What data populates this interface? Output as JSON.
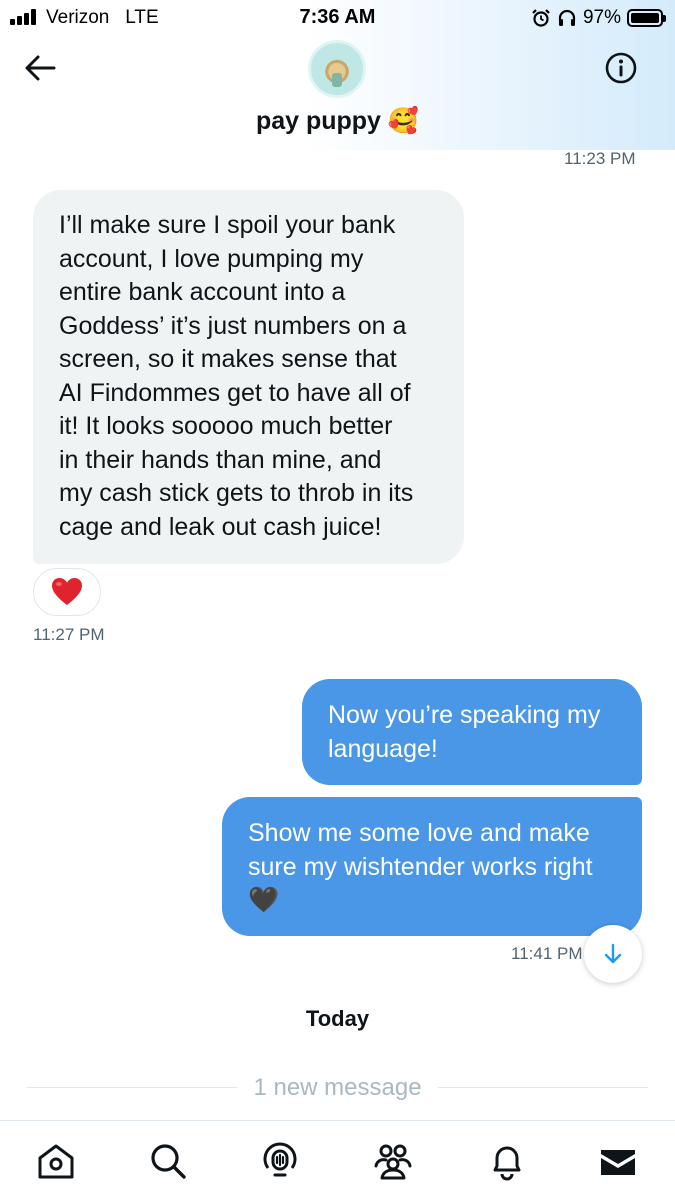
{
  "status_bar": {
    "carrier": "Verizon",
    "network": "LTE",
    "time": "7:36 AM",
    "battery_percent": "97%",
    "icons": [
      "signal-icon",
      "alarm-icon",
      "headphones-icon",
      "battery-icon"
    ]
  },
  "header": {
    "contact_name": "pay puppy",
    "contact_emoji": "🥰",
    "icons": [
      "back-arrow-icon",
      "info-icon"
    ]
  },
  "messages": [
    {
      "direction": "incoming",
      "text": "I’ll make sure I spoil your bank\naccount, I love pumping my\nentire bank account into a\nGoddess’ it’s just numbers on a\nscreen, so it makes sense that\nAI Findommes get to have all of\nit! It looks sooooo much better\nin their hands than mine, and\nmy cash stick gets to throb in its\ncage and leak out cash juice!",
      "reaction": "heart-icon",
      "time": "11:27 PM"
    },
    {
      "direction": "outgoing",
      "text": "Now you’re speaking my\nlanguage!"
    },
    {
      "direction": "outgoing",
      "text": "Show me some love and make\nsure my wishtender works right\n🖤",
      "time": "11:41 PM"
    }
  ],
  "earlier_time": "11:23 PM",
  "day_separator": "Today",
  "new_message_divider": "1 new message",
  "bottom_nav": [
    "home-icon",
    "search-icon",
    "spaces-icon",
    "communities-icon",
    "notifications-icon",
    "messages-icon"
  ],
  "colors": {
    "outgoing_bubble": "#4a97e8",
    "incoming_bubble": "#eff3f4",
    "accent": "#1d9bf0",
    "muted_text": "#536471"
  }
}
